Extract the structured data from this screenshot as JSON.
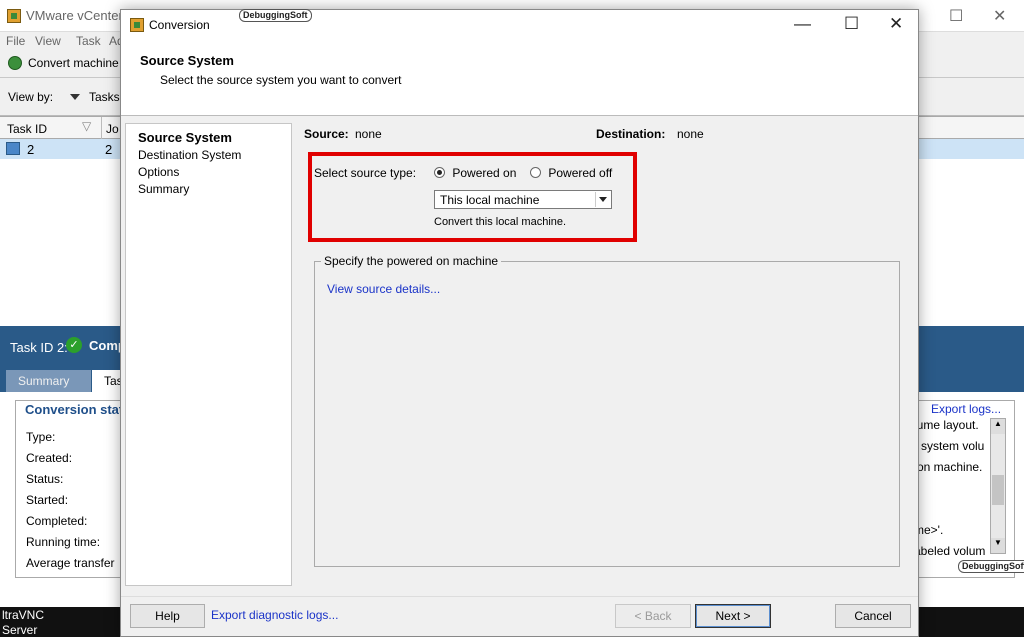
{
  "bg_app": {
    "title": "VMware vCenter",
    "menu": [
      "File",
      "View",
      "Task",
      "Ad"
    ],
    "toolbar_button": "Convert machine",
    "view_by_label": "View by:",
    "view_by_value": "Tasks",
    "table_headers": [
      "Task ID",
      "Jo"
    ],
    "table_row": [
      "2",
      "2"
    ],
    "detail_title": "Task ID 2:",
    "detail_status": "Comp",
    "tabs": [
      "Summary",
      "Tas"
    ],
    "section_title": "Conversion stat",
    "export_logs": "Export logs...",
    "fields": [
      "Type:",
      "Created:",
      "Status:",
      "Started:",
      "Completed:",
      "Running time:",
      "Average transfer"
    ],
    "log_lines": [
      "lume layout.",
      "system volu",
      "on machine.",
      "me>'.",
      "abeled volum"
    ],
    "taskbar_lines": [
      "ltraVNC",
      "Server"
    ],
    "watermark": "DebuggingSoft"
  },
  "dialog": {
    "title": "Conversion",
    "watermark": "DebuggingSoft",
    "header": {
      "title": "Source System",
      "subtitle": "Select the source system you want to convert"
    },
    "nav": [
      "Source System",
      "Destination System",
      "Options",
      "Summary"
    ],
    "source_label": "Source:",
    "source_value": "none",
    "destination_label": "Destination:",
    "destination_value": "none",
    "source_type_label": "Select source type:",
    "radio_on": "Powered on",
    "radio_off": "Powered off",
    "select_value": "This local machine",
    "select_hint": "Convert this local machine.",
    "group_title": "Specify the powered on machine",
    "view_details_link": "View source details...",
    "buttons": {
      "help": "Help",
      "export": "Export diagnostic logs...",
      "back": "< Back",
      "next": "Next >",
      "cancel": "Cancel"
    }
  },
  "colors": {
    "highlight_border": "#e00000",
    "link": "#1a33c8",
    "selection": "#cde3f6",
    "detail_header": "#2a5a88"
  }
}
